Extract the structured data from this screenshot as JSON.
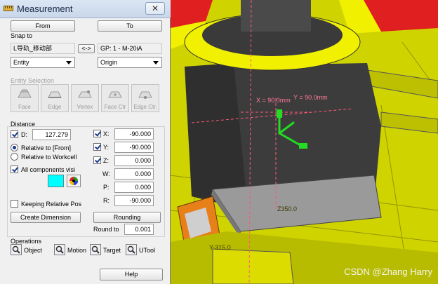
{
  "dialog": {
    "title": "Measurement",
    "close_glyph": "✕",
    "from_label": "From",
    "to_label": "To",
    "snap": {
      "section_label": "Snap to",
      "from_name": "L导轨_移动部",
      "swap_label": "<->",
      "to_name": "GP: 1 - M-20iA",
      "from_mode": "Entity",
      "to_mode": "Origin"
    },
    "entity_selection": {
      "section_label": "Entity Selection",
      "buttons": [
        "Face",
        "Edge",
        "Vertex",
        "Face Ctr",
        "Edge Ctr."
      ]
    },
    "distance": {
      "section_label": "Distance",
      "d_label": "D:",
      "d_value": "127.279",
      "relative_from_label": "Relative to [From]",
      "relative_workcell_label": "Relative to Workcell",
      "all_components_label": "All components visi",
      "color_swatch": "#00ffff",
      "keeping_relative_label": "Keeping Relative Pos",
      "create_dimension_label": "Create Dimension",
      "coords": [
        {
          "label": "X:",
          "value": "-90.000",
          "checkbox": true
        },
        {
          "label": "Y:",
          "value": "-90.000",
          "checkbox": true
        },
        {
          "label": "Z:",
          "value": "0.000",
          "checkbox": true
        },
        {
          "label": "W:",
          "value": "0.000",
          "checkbox": false
        },
        {
          "label": "P:",
          "value": "0.000",
          "checkbox": false
        },
        {
          "label": "R:",
          "value": "-90.000",
          "checkbox": false
        }
      ],
      "rounding_label": "Rounding",
      "round_to_label": "Round to",
      "round_to_value": "0.001"
    },
    "operations": {
      "section_label": "Operations",
      "items": [
        "Object",
        "Motion",
        "Target",
        "UTool"
      ]
    },
    "help_label": "Help"
  },
  "viewport": {
    "x_measure_label": "X = 90.0mm",
    "y_measure_label": "Y = 90.0mm",
    "z_label": "Z350.0",
    "y_label": "Y-315.0",
    "watermark": "CSDN @Zhang Harry",
    "colors": {
      "floor_yellow": "#d8dc00",
      "robot_red": "#e02020",
      "body_gray": "#3c3c3c",
      "triad_green": "#22dd22",
      "orange_part": "#e8801a"
    }
  }
}
